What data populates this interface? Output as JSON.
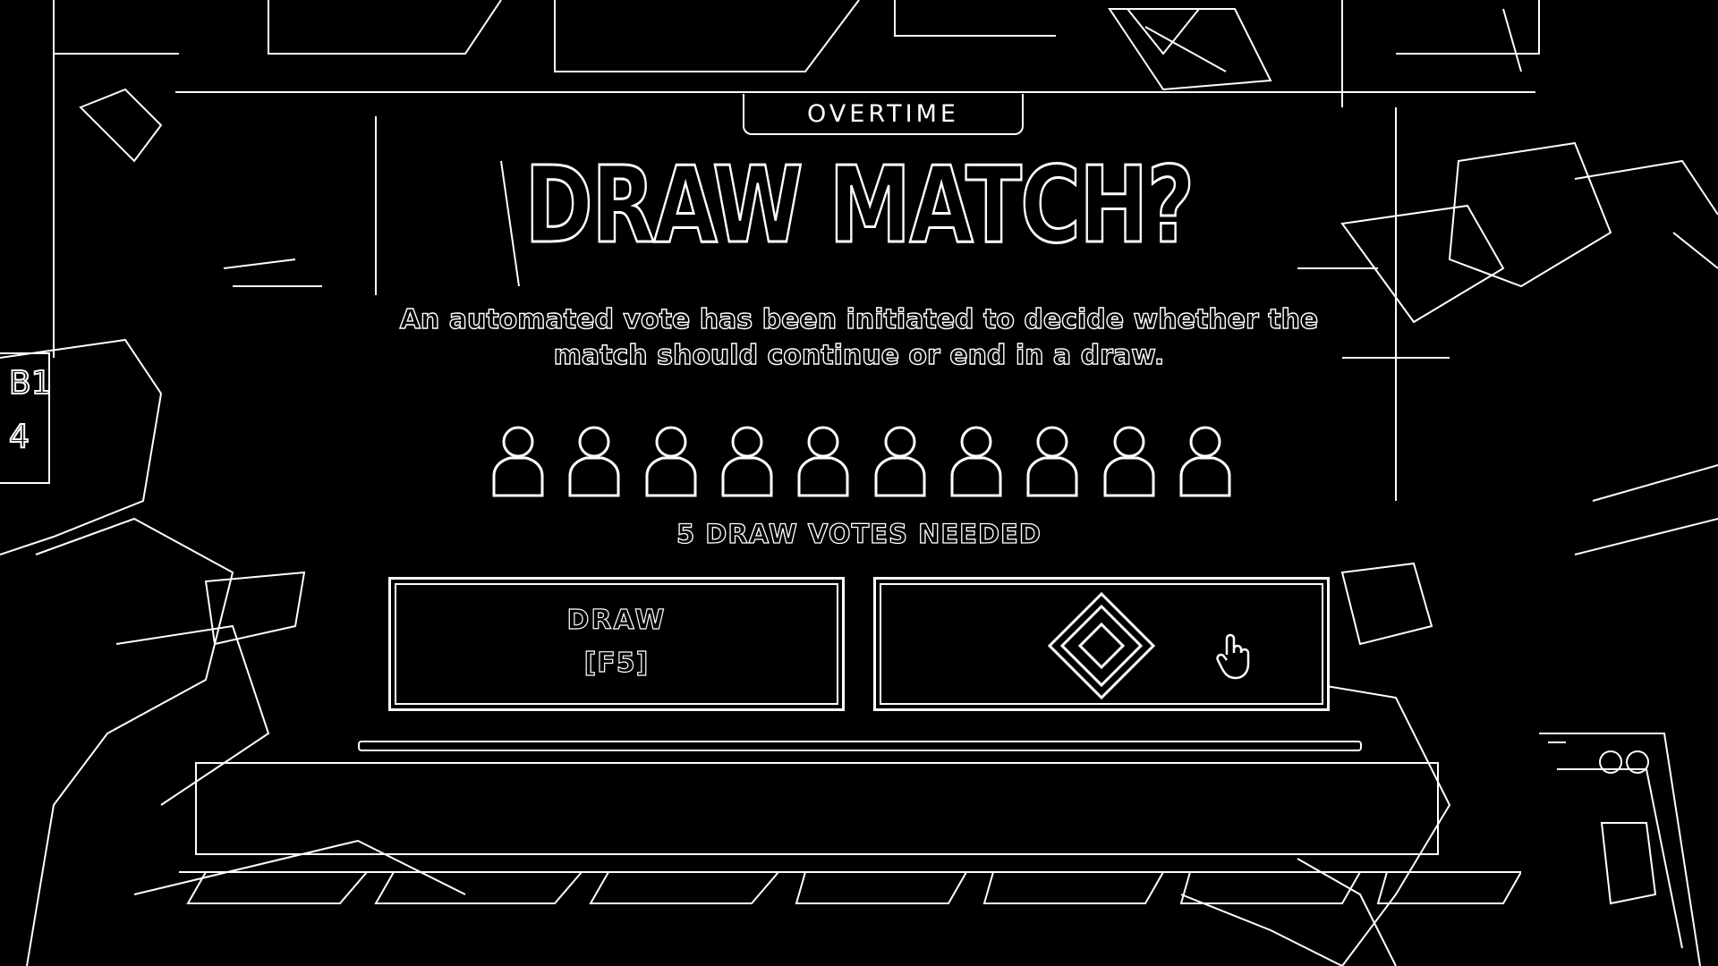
{
  "overlay": {
    "phase_label": "OVERTIME",
    "title": "DRAW MATCH?",
    "description_line1": "An automated vote has been initiated to decide whether the",
    "description_line2": "match should continue or end in a draw.",
    "votes_needed_text": "5 DRAW VOTES NEEDED",
    "players": [
      {
        "icon": "player-silhouette-icon"
      },
      {
        "icon": "player-silhouette-icon"
      },
      {
        "icon": "player-silhouette-icon"
      },
      {
        "icon": "player-silhouette-icon"
      },
      {
        "icon": "player-silhouette-icon"
      },
      {
        "icon": "player-silhouette-icon"
      },
      {
        "icon": "player-silhouette-icon"
      },
      {
        "icon": "player-silhouette-icon"
      },
      {
        "icon": "player-silhouette-icon"
      },
      {
        "icon": "player-silhouette-icon"
      }
    ],
    "draw_button": {
      "label": "DRAW",
      "key_hint": "[F5]"
    },
    "continue_button": {
      "icon": "diamond-key-icon",
      "cursor_icon": "hand-pointer-icon"
    }
  },
  "colors": {
    "background": "#000000",
    "line": "#ffffff"
  }
}
